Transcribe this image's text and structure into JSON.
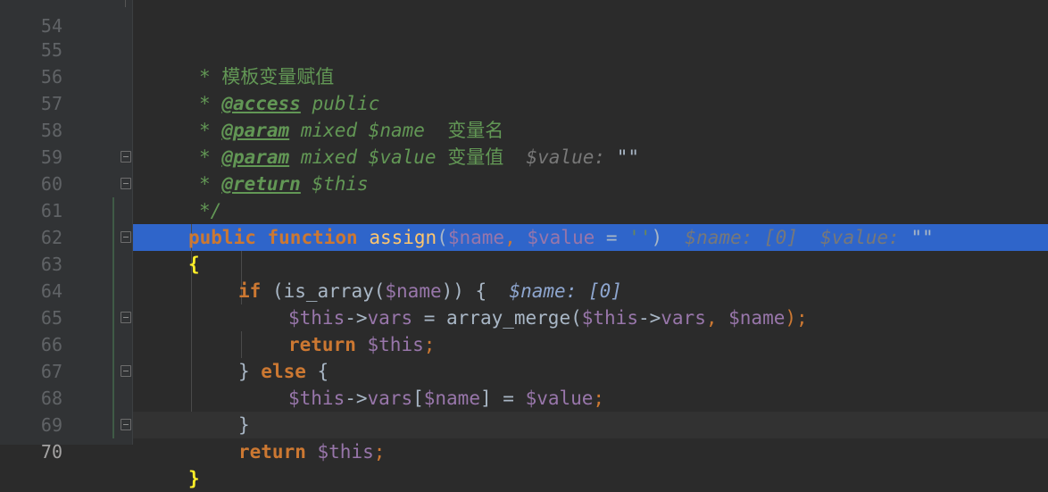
{
  "editor": {
    "lines": [
      {
        "n": "55",
        "comment_star": "*",
        "doc_text": "模板变量赋值"
      },
      {
        "n": "56",
        "comment_star": "*",
        "tag": "@access",
        "rest": "public"
      },
      {
        "n": "57",
        "comment_star": "*",
        "tag": "@param",
        "type": "mixed",
        "var": "$name",
        "desc": "变量名"
      },
      {
        "n": "58",
        "comment_star": "*",
        "tag": "@param",
        "type": "mixed",
        "var": "$value",
        "desc": "变量值",
        "hint": "$value:",
        "hint_val": "\"\""
      },
      {
        "n": "59",
        "comment_star": "*",
        "tag": "@return",
        "rest": "$this"
      },
      {
        "n": "60",
        "close": "*/"
      },
      {
        "n": "61",
        "kw1": "public",
        "kw2": "function",
        "fn": "assign",
        "open": "(",
        "p1": "$name",
        ",": ",",
        "p2": "$value",
        "eq": " = ",
        "def": "''",
        "close": ")",
        "hint1": "$name: [0]",
        "hint2": "$value:",
        "hint2_val": "\"\""
      },
      {
        "n": "62",
        "brace": "{"
      },
      {
        "n": "63",
        "kw": "if",
        "call": "(is_array(",
        "var": "$name",
        "tail": ")) {",
        "hint": "$name: [0]"
      },
      {
        "n": "64",
        "this": "$this",
        "arrow": "->",
        "prop": "vars",
        "mid": " = array_merge(",
        "this2": "$this",
        "arrow2": "->",
        "prop2": "vars",
        "comma": ", ",
        "var": "$name",
        "end": ");"
      },
      {
        "n": "65",
        "kw": "return",
        "this": "$this",
        "end": ";"
      },
      {
        "n": "66",
        "pre": "} ",
        "kw": "else",
        "post": " {"
      },
      {
        "n": "67",
        "this": "$this",
        "arrow": "->",
        "prop": "vars",
        "lb": "[",
        "var": "$name",
        "rb": "]",
        "eq": " = ",
        "var2": "$value",
        "end": ";"
      },
      {
        "n": "68",
        "brace": "}"
      },
      {
        "n": "69",
        "kw": "return",
        "this": "$this",
        "end": ";"
      },
      {
        "n": "70",
        "brace": "}"
      }
    ]
  }
}
